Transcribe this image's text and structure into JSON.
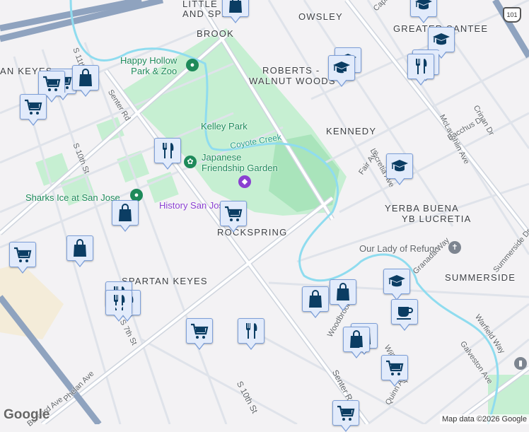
{
  "map": {
    "neighborhoods": [
      "LITTLE",
      "AND SPRING",
      "BROOK",
      "OWSLEY",
      "GREATER SANTEE",
      "AN KEYES",
      "ROBERTS -",
      "WALNUT WOODS",
      "KENNEDY",
      "YERBA BUENA",
      "YB LUCRETIA",
      "ROCKSPRING",
      "SPARTAN KEYES",
      "SUMMERSIDE"
    ],
    "places": {
      "happy_hollow": "Happy Hollow\nPark & Zoo",
      "kelley_park": "Kelley Park",
      "coyote_creek": "Coyote Creek",
      "japanese_garden": "Japanese\nFriendship Garden",
      "sharks_ice": "Sharks Ice at San Jose",
      "history_sj": "History San Jose",
      "our_lady": "Our Lady of Refuge"
    },
    "streets": [
      "Senter Rd",
      "S 10th St",
      "S 7th St",
      "Phelan Ave",
      "McLaughlin Ave",
      "Lucretia Ave",
      "Bacchus Dr",
      "Crinan Dr",
      "Fair Ave",
      "Granada Way",
      "Summerside Dr",
      "Warfield Way",
      "Galveston Ave",
      "Quinn Ave",
      "Will Wool Dr",
      "Woodbrook Dr",
      "Bernard Ave",
      "S 11th St",
      "Capitol Ave"
    ],
    "highway_shield": "101",
    "credit": "Map data ©2026 Google",
    "logo": "Google"
  },
  "marker_types": {
    "cart": "grocery-store",
    "bag": "shopping",
    "utensils": "restaurant",
    "school": "school",
    "coffee": "cafe"
  },
  "colors": {
    "park": "#bfeccd",
    "water": "#8fdcef",
    "road": "#ffffff",
    "road_edge": "#d3d8e0",
    "highway": "#8fa3bf",
    "marker_fill": "#e2ebfb",
    "marker_icon": "#0b3d63"
  }
}
